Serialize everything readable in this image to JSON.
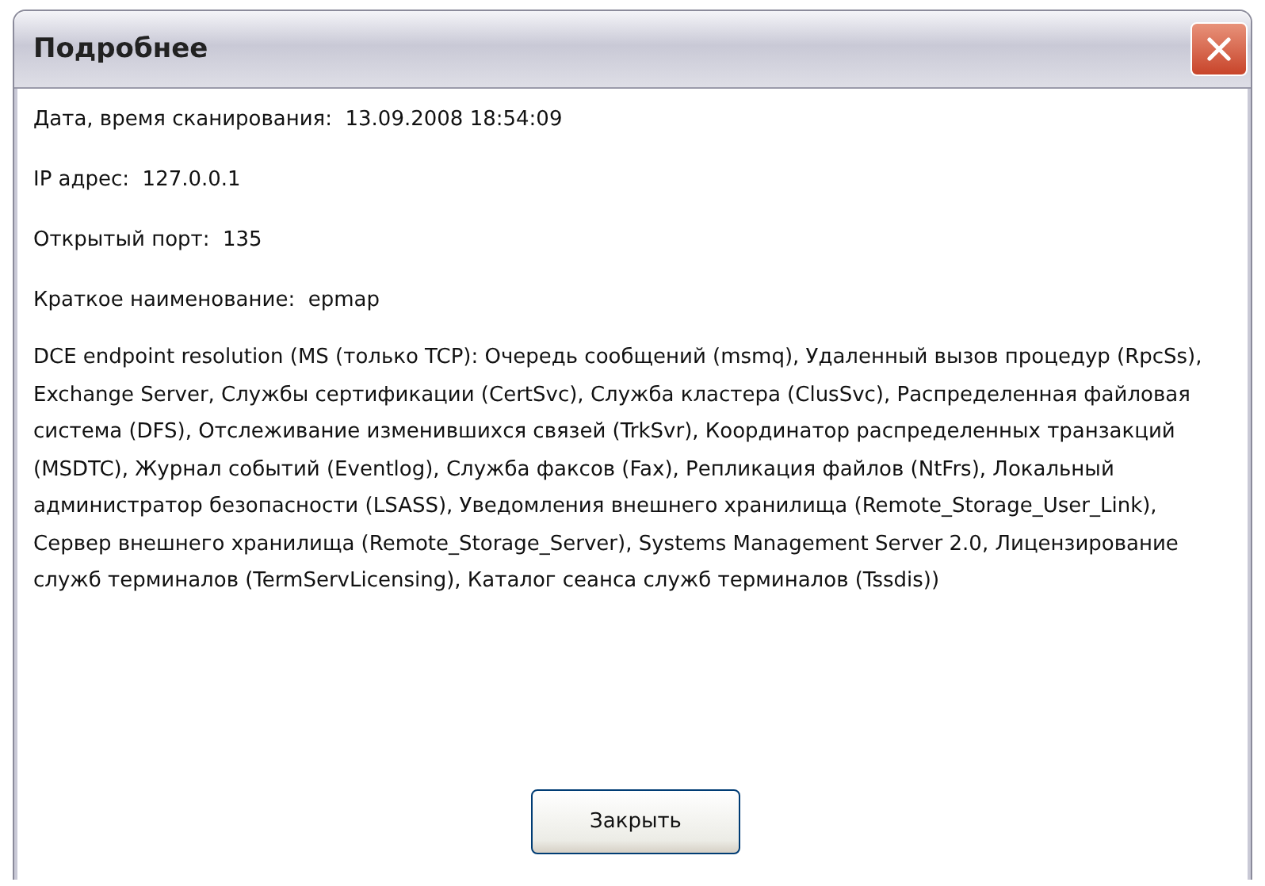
{
  "window": {
    "title": "Подробнее"
  },
  "fields": [
    {
      "label": "Дата, время сканирования:",
      "value": "13.09.2008 18:54:09"
    },
    {
      "label": "IP адрес:",
      "value": "127.0.0.1"
    },
    {
      "label": "Открытый порт:",
      "value": "135"
    },
    {
      "label": "Краткое наименование:",
      "value": "epmap"
    }
  ],
  "description": "DCE endpoint resolution (MS (только TCP): Очередь сообщений (msmq), Удаленный вызов процедур (RpcSs), Exchange Server, Службы сертификации (CertSvc), Служба кластера (ClusSvc), Распределенная файловая система (DFS), Отслеживание изменившихся связей (TrkSvr), Координатор распределенных транзакций (MSDTC), Журнал событий (Eventlog), Служба факсов (Fax), Репликация файлов (NtFrs), Локальный администратор безопасности (LSASS), Уведомления внешнего хранилища (Remote_Storage_User_Link), Сервер внешнего хранилища (Remote_Storage_Server), Systems Management Server 2.0, Лицензирование служб терминалов (TermServLicensing), Каталог сеанса служб терминалов (Tssdis))",
  "buttons": [
    {
      "label": "Закрыть"
    }
  ]
}
